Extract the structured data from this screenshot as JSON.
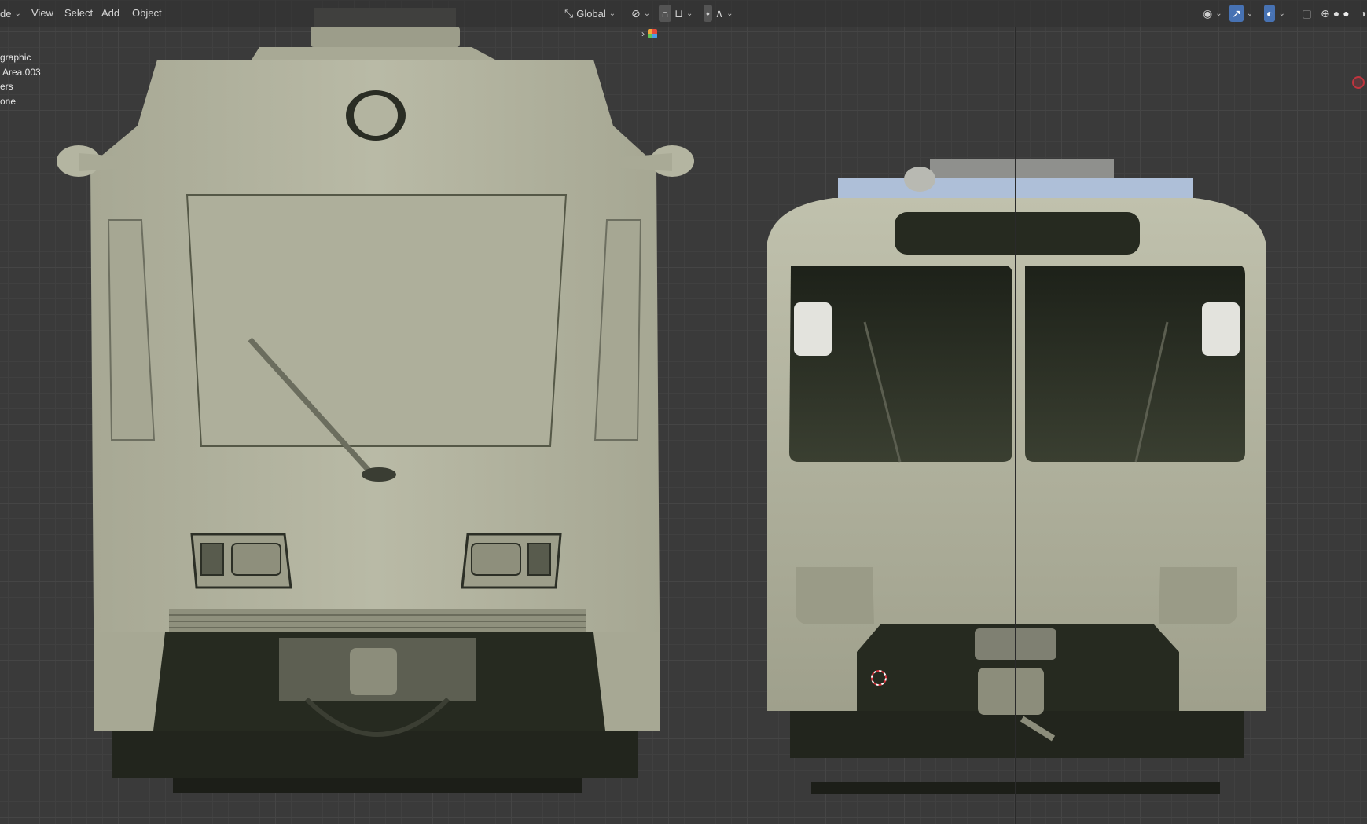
{
  "header": {
    "mode_partial": "de",
    "menus": [
      "View",
      "Select",
      "Add",
      "Object"
    ],
    "transform_orientation": "Global"
  },
  "overlay_info": {
    "lines": [
      "graphic",
      "Area.003",
      "ers",
      "one"
    ]
  },
  "colors": {
    "viewport_bg": "#3a3a3a",
    "model_body": "#b7b8a4",
    "model_dark": "#262a20",
    "roof_accent": "#aebfd8",
    "active_button": "#4772b3",
    "floor_line": "#9a4a52"
  },
  "icons": [
    "transform-orientation-icon",
    "pivot-icon",
    "snap-icon",
    "proportional-edit-icon",
    "falloff-curve-icon",
    "visibility-icon",
    "gizmo-icon",
    "overlay-icon",
    "xray-icon",
    "wireframe-icon",
    "solid-shading-icon",
    "material-shading-icon",
    "rendered-shading-icon",
    "collapse-arrow-icon",
    "editor-type-icon",
    "3d-cursor-icon"
  ]
}
